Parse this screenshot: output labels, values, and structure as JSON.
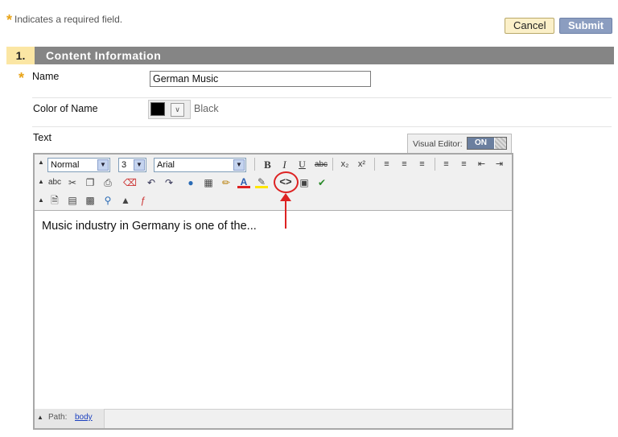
{
  "required_note": {
    "star": "*",
    "text": "Indicates a required field."
  },
  "actions": {
    "cancel": "Cancel",
    "submit": "Submit"
  },
  "section": {
    "number": "1.",
    "title": "Content Information"
  },
  "name_field": {
    "star": "*",
    "label": "Name",
    "value": "German Music"
  },
  "color_field": {
    "label": "Color of Name",
    "value": "Black",
    "swatch_color": "#000000"
  },
  "text_field": {
    "label": "Text"
  },
  "visual_editor": {
    "label": "Visual Editor:",
    "state": "ON"
  },
  "toolbar": {
    "format": "Normal",
    "size": "3",
    "font": "Arial",
    "bold": "B",
    "italic": "I",
    "underline": "U",
    "strikethrough": "abc",
    "spell": "abc",
    "html_source": "<>"
  },
  "editor": {
    "content": "Music industry in Germany is one of the..."
  },
  "status": {
    "path_label": "Path:",
    "path_value": "body"
  },
  "colors": {
    "accent_red": "#dd2222",
    "section_bar": "#858585",
    "section_num_bg": "#fbe6a4",
    "submit_bg": "#8b9dc0",
    "cancel_bg": "#fbf0c9",
    "required_star": "#e8a317"
  }
}
